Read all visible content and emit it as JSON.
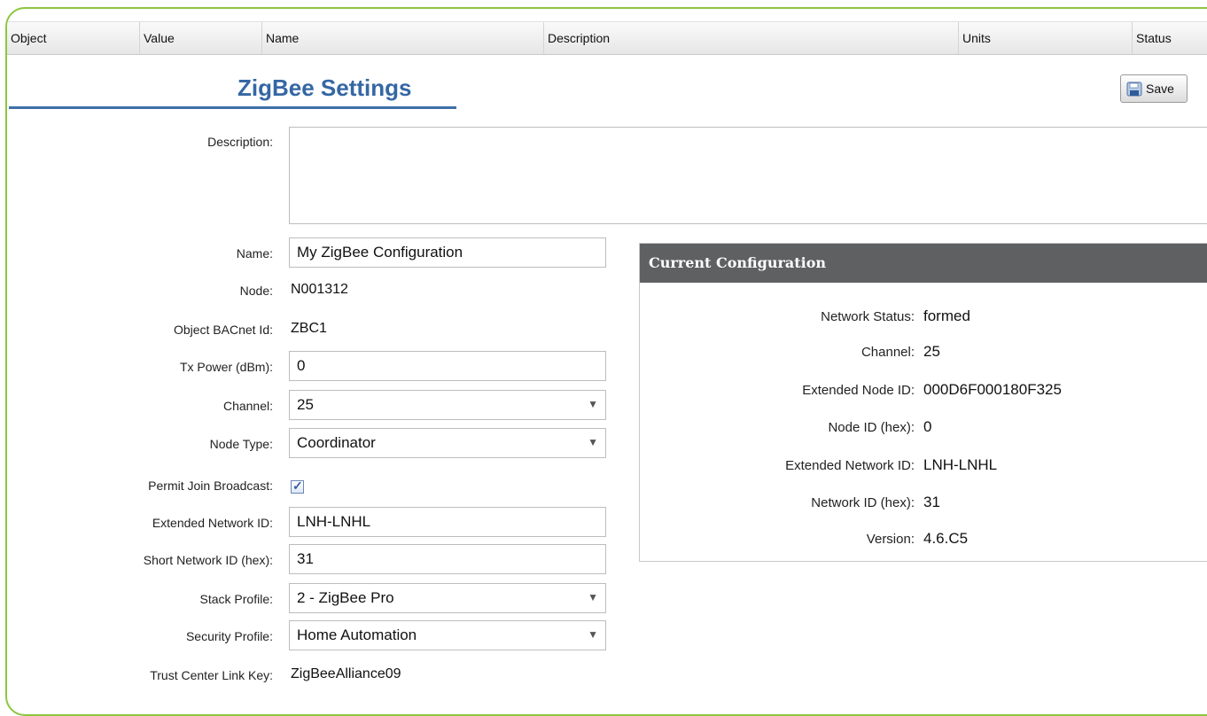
{
  "header": {
    "columns": [
      "Object",
      "Value",
      "Name",
      "Description",
      "Units",
      "Status"
    ]
  },
  "page": {
    "title": "ZigBee Settings",
    "save_label": "Save"
  },
  "form": {
    "description_label": "Description:",
    "description_value": "",
    "name_label": "Name:",
    "name_value": "My ZigBee Configuration",
    "node_label": "Node:",
    "node_value": "N001312",
    "bacnet_label": "Object BACnet Id:",
    "bacnet_value": "ZBC1",
    "txpower_label": "Tx Power (dBm):",
    "txpower_value": "0",
    "channel_label": "Channel:",
    "channel_value": "25",
    "nodetype_label": "Node Type:",
    "nodetype_value": "Coordinator",
    "permit_label": "Permit Join Broadcast:",
    "permit_checked": true,
    "extnet_label": "Extended Network ID:",
    "extnet_value": "LNH-LNHL",
    "shortnet_label": "Short Network ID (hex):",
    "shortnet_value": "31",
    "stack_label": "Stack Profile:",
    "stack_value": "2 - ZigBee Pro",
    "security_label": "Security Profile:",
    "security_value": "Home Automation",
    "trust_label": "Trust Center Link Key:",
    "trust_value": "ZigBeeAlliance09"
  },
  "current": {
    "title": "Current Configuration",
    "rows": [
      {
        "label": "Network Status:",
        "value": "formed"
      },
      {
        "label": "Channel:",
        "value": "25"
      },
      {
        "label": "Extended Node ID:",
        "value": "000D6F000180F325"
      },
      {
        "label": "Node ID (hex):",
        "value": "0"
      },
      {
        "label": "Extended Network ID:",
        "value": "LNH-LNHL"
      },
      {
        "label": "Network ID (hex):",
        "value": "31"
      },
      {
        "label": "Version:",
        "value": "4.6.C5"
      }
    ]
  },
  "colors": {
    "frame_border": "#8cc63f",
    "title_blue": "#3567a4",
    "panel_header": "#5f6062"
  }
}
